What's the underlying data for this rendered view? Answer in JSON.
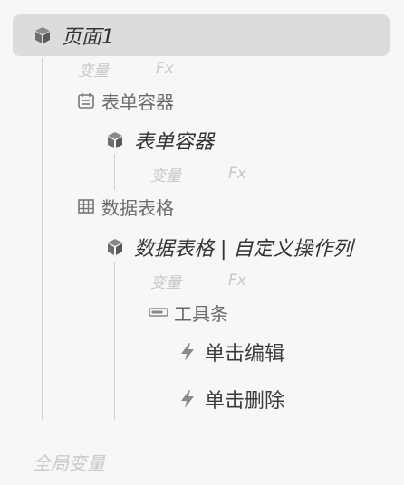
{
  "tree": {
    "root": {
      "label": "页面1",
      "icon": "cube-icon",
      "var_label": "变量",
      "fx_label": "Fx"
    },
    "form_container": {
      "group_label": "表单容器",
      "group_icon": "form-container-icon",
      "component_label": "表单容器",
      "component_icon": "cube-icon",
      "var_label": "变量",
      "fx_label": "Fx"
    },
    "data_table": {
      "group_label": "数据表格",
      "group_icon": "table-grid-icon",
      "component_label": "数据表格 | 自定义操作列",
      "component_icon": "cube-icon",
      "var_label": "变量",
      "fx_label": "Fx",
      "toolbar": {
        "label": "工具条",
        "icon": "toolbar-icon",
        "events": [
          {
            "label": "单击编辑",
            "icon": "lightning-icon"
          },
          {
            "label": "单击删除",
            "icon": "lightning-icon"
          }
        ]
      }
    }
  },
  "footer": {
    "global_vars_label": "全局变量"
  }
}
